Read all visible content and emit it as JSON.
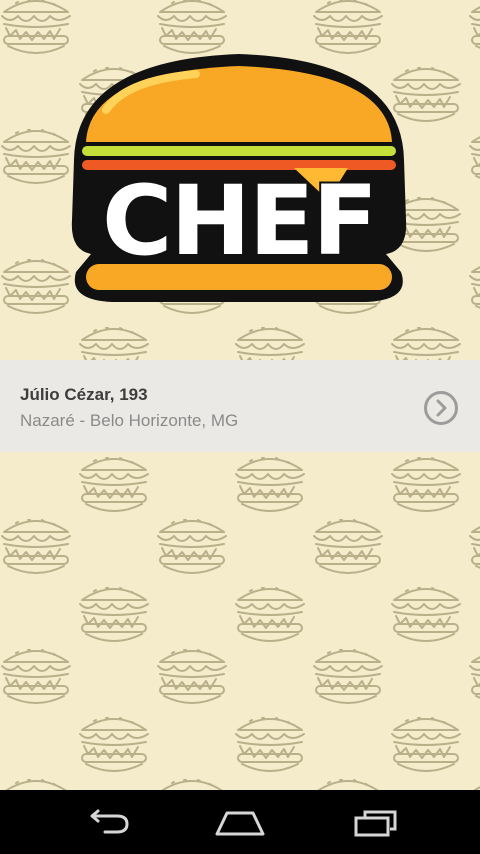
{
  "logo": {
    "text": "CHEF"
  },
  "address": {
    "street": "Júlio Cézar, 193",
    "city": "Nazaré - Belo Horizonte, MG"
  },
  "icons": {
    "go": "chevron-right-circle-icon",
    "back": "back-icon",
    "home": "home-icon",
    "recents": "recents-icon"
  },
  "colors": {
    "background": "#f5eccb",
    "pattern_stroke": "#b9b08a",
    "bun": "#f9a825",
    "lettuce": "#c6e03a",
    "tomato": "#ef5a24",
    "cheese": "#ffb933",
    "card": "#ebe9e6",
    "navbar": "#000000"
  }
}
